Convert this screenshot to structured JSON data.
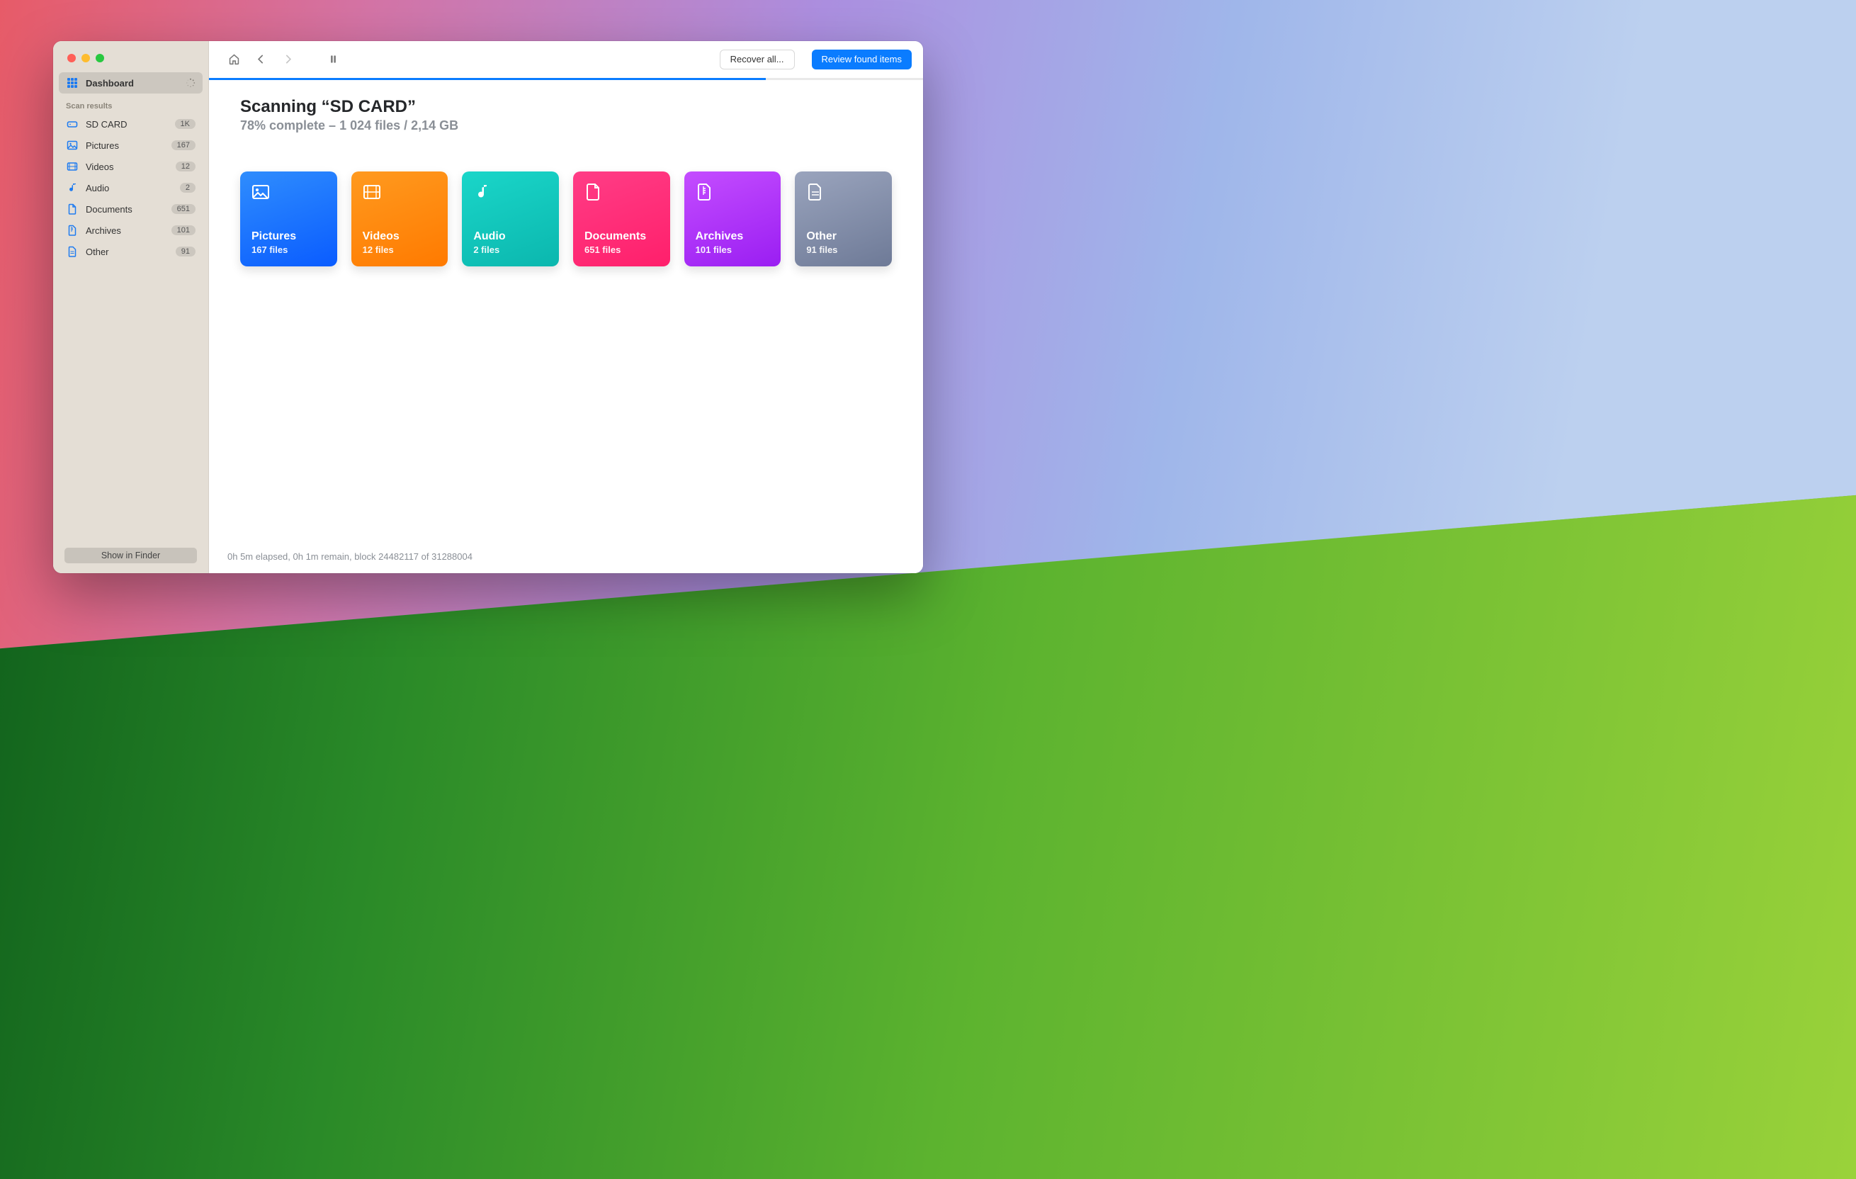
{
  "sidebar": {
    "dashboard_label": "Dashboard",
    "section_label": "Scan results",
    "items": [
      {
        "label": "SD CARD",
        "badge": "1K",
        "icon": "drive"
      },
      {
        "label": "Pictures",
        "badge": "167",
        "icon": "picture"
      },
      {
        "label": "Videos",
        "badge": "12",
        "icon": "video"
      },
      {
        "label": "Audio",
        "badge": "2",
        "icon": "audio"
      },
      {
        "label": "Documents",
        "badge": "651",
        "icon": "document"
      },
      {
        "label": "Archives",
        "badge": "101",
        "icon": "archive"
      },
      {
        "label": "Other",
        "badge": "91",
        "icon": "other"
      }
    ],
    "show_in_finder_label": "Show in Finder"
  },
  "toolbar": {
    "recover_all_label": "Recover all...",
    "review_label": "Review found items"
  },
  "progress": {
    "percent": 78
  },
  "header": {
    "title": "Scanning “SD CARD”",
    "subtitle": "78% complete – 1 024 files / 2,14 GB"
  },
  "cards": [
    {
      "name": "Pictures",
      "count_label": "167 files",
      "kind": "pictures"
    },
    {
      "name": "Videos",
      "count_label": "12 files",
      "kind": "videos"
    },
    {
      "name": "Audio",
      "count_label": "2 files",
      "kind": "audio"
    },
    {
      "name": "Documents",
      "count_label": "651 files",
      "kind": "documents"
    },
    {
      "name": "Archives",
      "count_label": "101 files",
      "kind": "archives"
    },
    {
      "name": "Other",
      "count_label": "91 files",
      "kind": "other"
    }
  ],
  "footer": {
    "status": "0h 5m elapsed, 0h 1m remain, block 24482117 of 31288004"
  }
}
